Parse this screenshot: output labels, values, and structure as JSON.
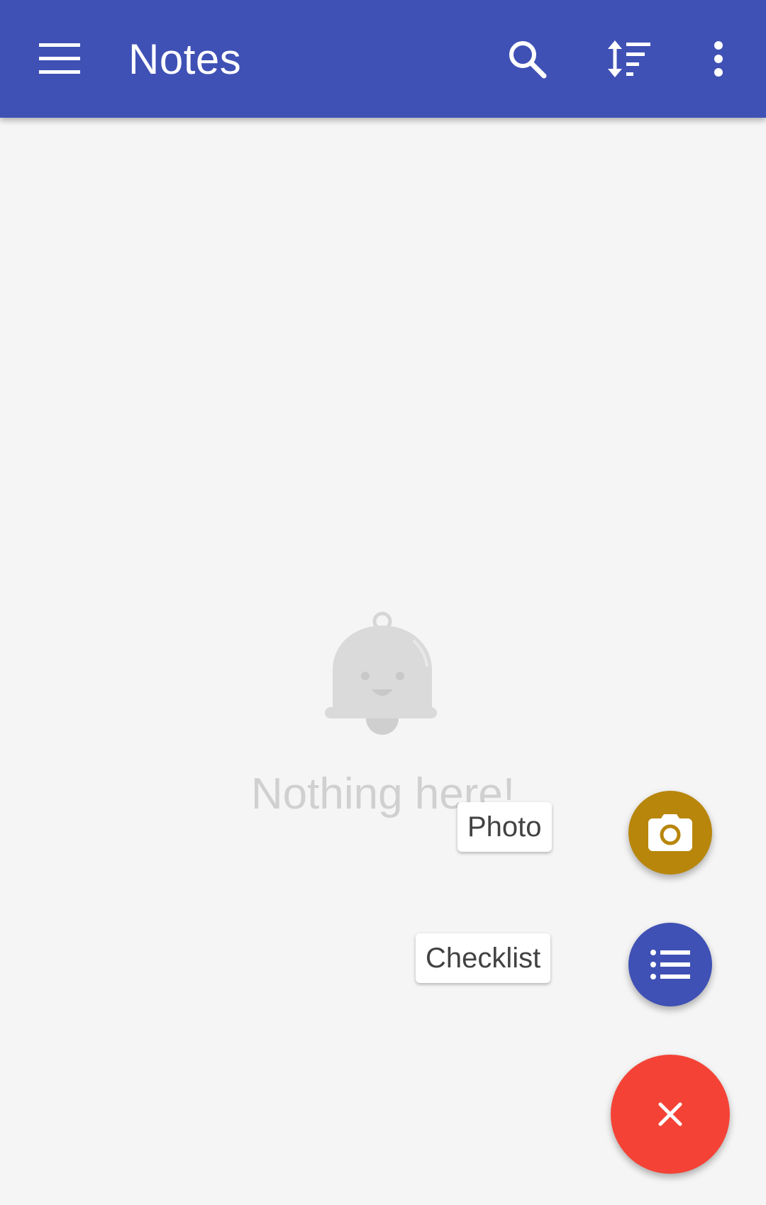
{
  "toolbar": {
    "title": "Notes",
    "background_color": "#3f51b5",
    "menu_icon": "hamburger-menu-icon",
    "search_icon": "search-icon",
    "sort_icon": "sort-icon",
    "more_icon": "more-vertical-icon"
  },
  "empty_state": {
    "icon": "bell-icon",
    "message": "Nothing here!"
  },
  "fab_menu": {
    "items": [
      {
        "label": "Photo",
        "icon": "camera-icon",
        "color": "#b8860b"
      },
      {
        "label": "Checklist",
        "icon": "checklist-icon",
        "color": "#3f51b5"
      }
    ],
    "close": {
      "icon": "close-icon",
      "color": "#f44336"
    }
  }
}
